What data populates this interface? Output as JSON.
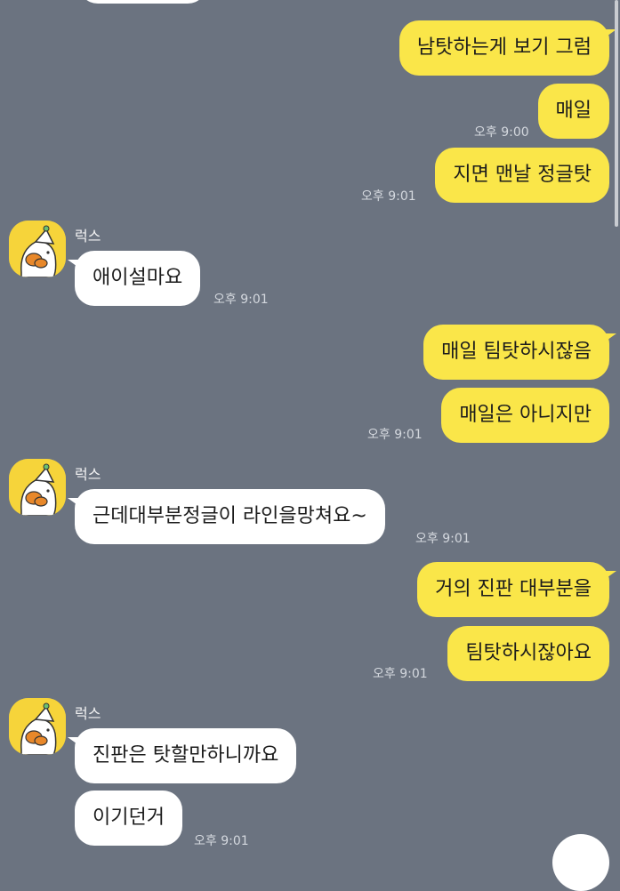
{
  "chat": {
    "partner_name": "럭스",
    "top_time_fragment": "오후 9:00",
    "messages": [
      {
        "text": "남탓하는게 보기 그럼"
      },
      {
        "text": "매일"
      },
      {
        "text": "지면 맨날 정글탓"
      },
      {
        "text": "애이설마요"
      },
      {
        "text": "매일 팀탓하시잖음"
      },
      {
        "text": "매일은 아니지만"
      },
      {
        "text": "근데대부분정글이 라인을망쳐요~"
      },
      {
        "text": "거의 진판 대부분을"
      },
      {
        "text": "팀탓하시잖아요"
      },
      {
        "text": "진판은 탓할만하니까요"
      },
      {
        "text": "이기던거"
      }
    ],
    "times": [
      "오후 9:00",
      "오후 9:01",
      "오후 9:01",
      "오후 9:01",
      "오후 9:01",
      "오후 9:01",
      "오후 9:01"
    ]
  },
  "colors": {
    "background": "#6b7380",
    "outgoing_bubble": "#fae649",
    "incoming_bubble": "#ffffff"
  },
  "icons": {
    "avatar": "yellow-duck-character-avatar",
    "scroll_button": "scroll-down-button"
  }
}
